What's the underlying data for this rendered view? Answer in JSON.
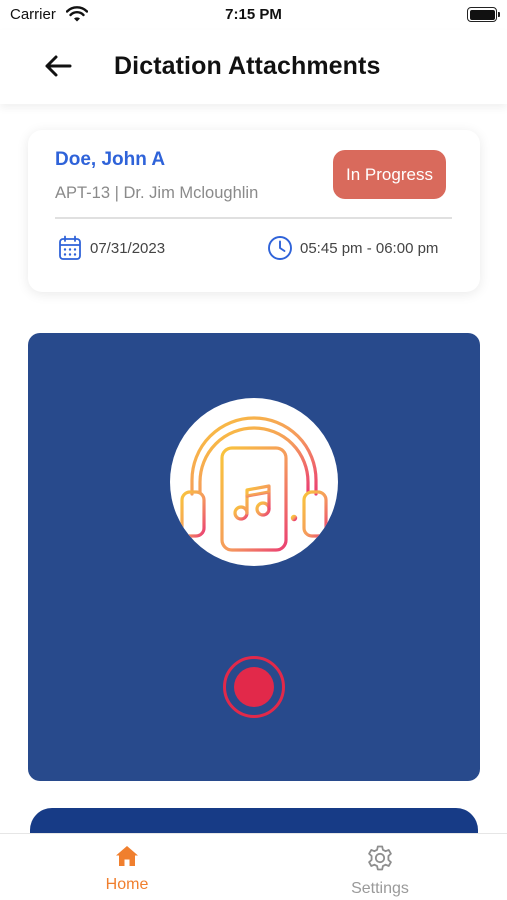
{
  "status_bar": {
    "carrier": "Carrier",
    "time": "7:15 PM"
  },
  "header": {
    "title": "Dictation Attachments",
    "back_icon": "arrow-left-icon"
  },
  "appointment": {
    "patient_name": "Doe, John A",
    "subtitle": "APT-13 | Dr. Jim Mcloughlin",
    "status": "In Progress",
    "status_color": "#d96a5c",
    "date": "07/31/2023",
    "time_range": "05:45 pm - 06:00 pm",
    "date_icon": "calendar-icon",
    "time_icon": "clock-icon"
  },
  "recorder": {
    "panel_color": "#284a8c",
    "illustration_icon": "headphones-phone-music-icon",
    "record_icon": "record-icon",
    "record_color": "#e2294a"
  },
  "tabs": [
    {
      "label": "Home",
      "icon": "home-icon",
      "active": true
    },
    {
      "label": "Settings",
      "icon": "gear-icon",
      "active": false
    }
  ],
  "colors": {
    "accent": "#f07f2e",
    "link_blue": "#2f63d9"
  }
}
